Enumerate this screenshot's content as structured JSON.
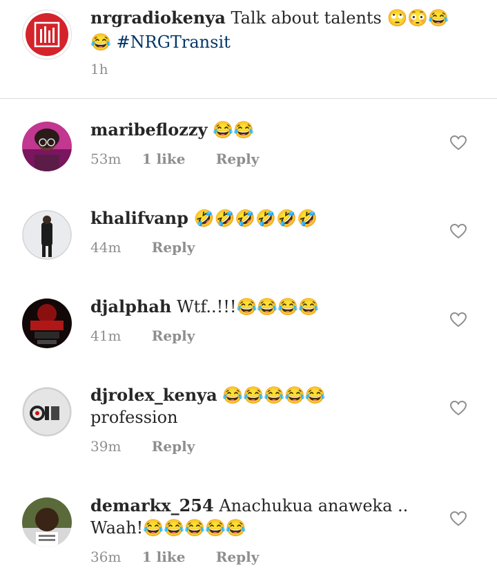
{
  "caption": {
    "username": "nrgradiokenya",
    "text": "Talk about talents 🙄😳😂",
    "text2": "😂",
    "hashtag": "#NRGTransit",
    "time": "1h"
  },
  "comments": [
    {
      "username": "maribeflozzy",
      "text": "😂😂",
      "time": "53m",
      "likes": "1 like",
      "reply": "Reply",
      "avatar": "avatar-pink-girl"
    },
    {
      "username": "khalifvanp",
      "text": "🤣🤣🤣🤣🤣🤣",
      "time": "44m",
      "likes": "",
      "reply": "Reply",
      "avatar": "avatar-man-standing"
    },
    {
      "username": "djalphah",
      "text": "Wtf..!!!😂😂😂😂",
      "time": "41m",
      "likes": "",
      "reply": "Reply",
      "avatar": "avatar-dj-alphah-logo"
    },
    {
      "username": "djrolex_kenya",
      "text": "😂😂😂😂😂",
      "text2": "profession",
      "time": "39m",
      "likes": "",
      "reply": "Reply",
      "avatar": "avatar-djrolex-logo"
    },
    {
      "username": "demarkx_254",
      "text": "Anachukua anaweka ..",
      "text2": "Waah!😂😂😂😂😂",
      "time": "36m",
      "likes": "1 like",
      "reply": "Reply",
      "avatar": "avatar-young-man"
    }
  ],
  "icons": {
    "like": "heart-outline-icon"
  },
  "colors": {
    "username": "#262626",
    "meta": "#8e8e8e",
    "hashtag": "#003569",
    "brand_red": "#d4232b"
  }
}
